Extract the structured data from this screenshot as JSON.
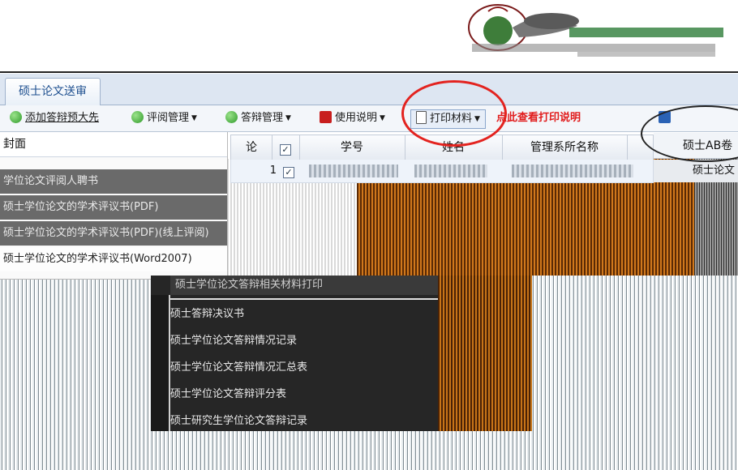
{
  "window": {
    "tab_label": "硕士论文送审"
  },
  "toolbar": {
    "add_expert_label": "添加答辩预大先",
    "review_manage_label": "评阅管理",
    "defense_manage_label": "答辩管理",
    "usage_guide_label": "使用说明",
    "print_materials_label": "打印材料",
    "print_hint": "点此查看打印说明"
  },
  "menu": {
    "header": "封面",
    "items": [
      {
        "label": "学位论文评阅人聘书"
      },
      {
        "label": "硕士学位论文的学术评议书(PDF)"
      },
      {
        "label": "硕士学位论文的学术评议书(PDF)(线上评阅)"
      },
      {
        "label": "硕士学位论文的学术评议书(Word2007)"
      }
    ]
  },
  "grid": {
    "columns": [
      "论",
      "学号",
      "姓名",
      "管理系所名称"
    ],
    "rows": [
      {
        "index": "1"
      }
    ]
  },
  "right_panel": {
    "header": "硕士AB卷",
    "row_text": "硕士论文"
  },
  "submenu": {
    "header": "硕士学位论文答辩相关材料打印",
    "items": [
      {
        "label": "硕士答辩决议书"
      },
      {
        "label": "硕士学位论文答辩情况记录"
      },
      {
        "label": "硕士学位论文答辩情况汇总表"
      },
      {
        "label": "硕士学位论文答辩评分表"
      },
      {
        "label": "硕士研究生学位论文答辩记录"
      }
    ]
  },
  "colors": {
    "annotation_red": "#e3231f",
    "accent_blue": "#1d4f8f"
  },
  "icons": {
    "add": "green-circle-icon",
    "review": "green-circle-icon",
    "defense": "green-circle-icon",
    "guide": "red-book-icon",
    "print": "document-icon"
  }
}
